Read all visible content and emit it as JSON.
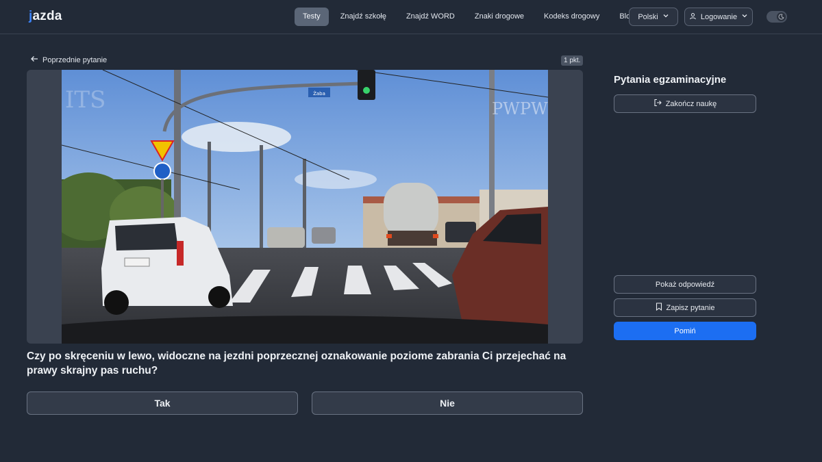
{
  "header": {
    "logo_text": "jazda",
    "nav": [
      {
        "label": "Testy",
        "active": true
      },
      {
        "label": "Znajdź szkołę",
        "active": false
      },
      {
        "label": "Znajdź WORD",
        "active": false
      },
      {
        "label": "Znaki drogowe",
        "active": false
      },
      {
        "label": "Kodeks drogowy",
        "active": false
      },
      {
        "label": "Blog",
        "active": false
      }
    ],
    "language": "Polski",
    "login": "Logowanie",
    "theme_toggle_icon": "moon-icon"
  },
  "main": {
    "back_label": "Poprzednie pytanie",
    "points": "1 pkt.",
    "image": {
      "description_icon": "traffic-scene",
      "watermark_right": "PWPW",
      "street_sign": "Żaba"
    },
    "question": "Czy po skręceniu w lewo, widoczne na jezdni poprzecznej oznakowanie poziome zabrania Ci przejechać na prawy skrajny pas ruchu?",
    "answers": [
      "Tak",
      "Nie"
    ]
  },
  "sidebar": {
    "title": "Pytania egzaminacyjne",
    "end_label": "Zakończ naukę",
    "show_answer_label": "Pokaż odpowiedź",
    "save_label": "Zapisz pytanie",
    "skip_label": "Pomiń"
  },
  "colors": {
    "background": "#222a37",
    "accent": "#1c6ef2",
    "nav_active": "#5b6677"
  }
}
